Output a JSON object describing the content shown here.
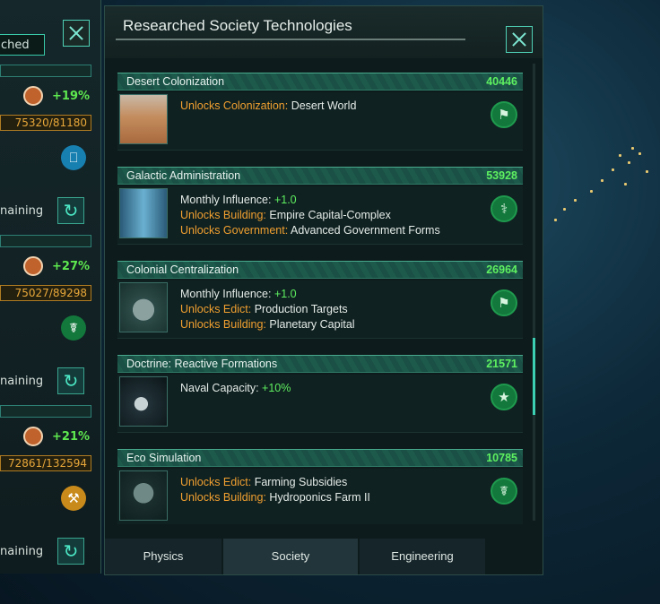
{
  "window": {
    "title": "Researched Society Technologies",
    "tabs": [
      "Physics",
      "Society",
      "Engineering"
    ],
    "active_tab": "Society"
  },
  "left_panel": {
    "title_partial": "ched",
    "rows": [
      {
        "pct": "+19%",
        "amount": "75320/81180",
        "remaining": "naining",
        "category_icon": "computer-icon"
      },
      {
        "pct": "+27%",
        "amount": "75027/89298",
        "remaining": "naining",
        "category_icon": "dna-icon"
      },
      {
        "pct": "+21%",
        "amount": "72861/132594",
        "remaining": "naining",
        "category_icon": "industry-icon"
      }
    ]
  },
  "technologies": [
    {
      "name": "Desert Colonization",
      "cost": "40446",
      "icon": "flag-icon",
      "image": "desert-image",
      "effects": [
        {
          "key": "Unlocks Colonization:",
          "key_color": "orange",
          "value": "Desert World",
          "value_color": "white"
        }
      ]
    },
    {
      "name": "Galactic Administration",
      "cost": "53928",
      "icon": "handshake-icon",
      "image": "administration-image",
      "effects": [
        {
          "key": "Monthly Influence:",
          "key_color": "white",
          "value": "+1.0",
          "value_color": "green"
        },
        {
          "key": "Unlocks Building:",
          "key_color": "orange",
          "value": "Empire Capital-Complex",
          "value_color": "white"
        },
        {
          "key": "Unlocks Government:",
          "key_color": "orange",
          "value": "Advanced Government Forms",
          "value_color": "white"
        }
      ]
    },
    {
      "name": "Colonial Centralization",
      "cost": "26964",
      "icon": "flag-icon",
      "image": "centralization-image",
      "effects": [
        {
          "key": "Monthly Influence:",
          "key_color": "white",
          "value": "+1.0",
          "value_color": "green"
        },
        {
          "key": "Unlocks Edict:",
          "key_color": "orange",
          "value": "Production Targets",
          "value_color": "white"
        },
        {
          "key": "Unlocks Building:",
          "key_color": "orange",
          "value": "Planetary Capital",
          "value_color": "white"
        }
      ]
    },
    {
      "name": "Doctrine: Reactive Formations",
      "cost": "21571",
      "icon": "military-rank-icon",
      "image": "ship-image",
      "effects": [
        {
          "key": "Naval Capacity:",
          "key_color": "white",
          "value": "+10%",
          "value_color": "green"
        }
      ]
    },
    {
      "name": "Eco Simulation",
      "cost": "10785",
      "icon": "dna-icon",
      "image": "dome-image",
      "effects": [
        {
          "key": "Unlocks Edict:",
          "key_color": "orange",
          "value": "Farming Subsidies",
          "value_color": "white"
        },
        {
          "key": "Unlocks Building:",
          "key_color": "orange",
          "value": "Hydroponics Farm II",
          "value_color": "white"
        }
      ]
    }
  ]
}
